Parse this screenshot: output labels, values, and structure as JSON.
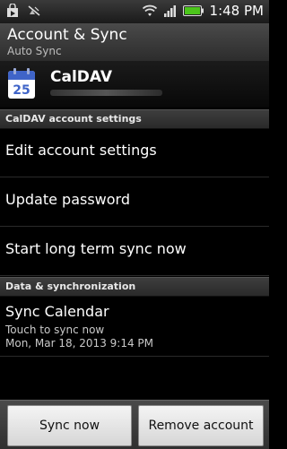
{
  "status_bar": {
    "time": "1:48",
    "ampm": "PM"
  },
  "header": {
    "title": "Account & Sync",
    "subtitle": "Auto Sync"
  },
  "account": {
    "name": "CalDAV",
    "icon_day": "25",
    "icon": "calendar-icon"
  },
  "sections": {
    "caldav_settings": "CalDAV account settings",
    "data_sync": "Data & synchronization"
  },
  "items": {
    "edit_account": "Edit account settings",
    "update_password": "Update password",
    "long_term_sync": "Start long term sync now"
  },
  "sync_calendar": {
    "title": "Sync Calendar",
    "hint": "Touch to sync now",
    "last_sync": "Mon, Mar 18, 2013 9:14 PM"
  },
  "buttons": {
    "sync_now": "Sync now",
    "remove_account": "Remove account"
  },
  "colors": {
    "accent_blue": "#3f64c8",
    "battery_green": "#4cc61b"
  }
}
